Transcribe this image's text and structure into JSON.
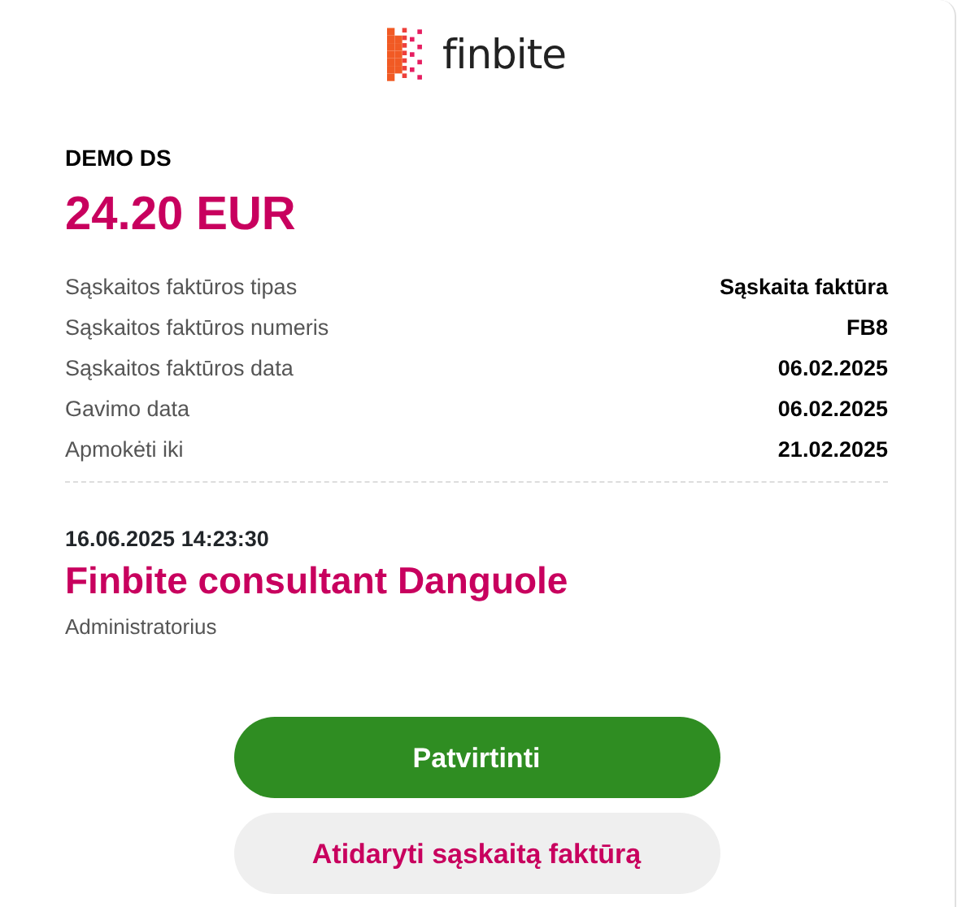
{
  "logo": {
    "text": "finbite"
  },
  "invoice": {
    "company": "DEMO DS",
    "amount": "24.20 EUR",
    "details": [
      {
        "label": "Sąskaitos faktūros tipas",
        "value": "Sąskaita faktūra"
      },
      {
        "label": "Sąskaitos faktūros numeris",
        "value": "FB8"
      },
      {
        "label": "Sąskaitos faktūros data",
        "value": "06.02.2025"
      },
      {
        "label": "Gavimo data",
        "value": "06.02.2025"
      },
      {
        "label": "Apmokėti iki",
        "value": "21.02.2025"
      }
    ]
  },
  "approver": {
    "timestamp": "16.06.2025 14:23:30",
    "name": "Finbite consultant Danguole",
    "role": "Administratorius"
  },
  "buttons": [
    {
      "label": "Patvirtinti",
      "kind": "primary"
    },
    {
      "label": "Atidaryti sąskaitą faktūrą",
      "kind": "secondary"
    }
  ]
}
